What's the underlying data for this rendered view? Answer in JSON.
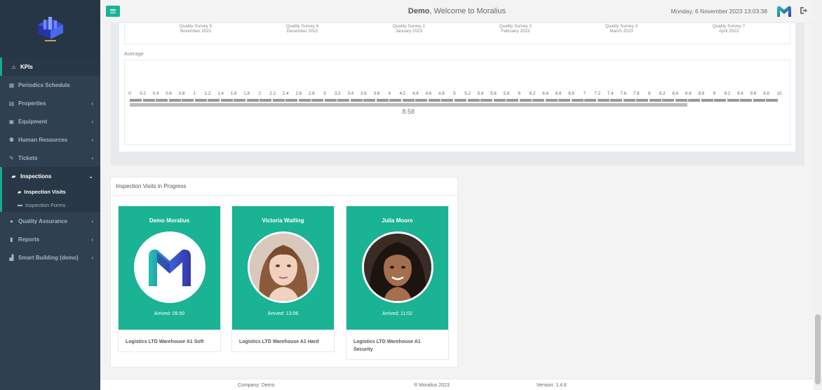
{
  "header": {
    "brand": "Demo",
    "welcome": ", Welcome to Moralius",
    "datetime": "Monday, 6 November 2023 13:03:38"
  },
  "sidebar": {
    "items": [
      {
        "label": "KPIs",
        "icon": "home-icon",
        "active": true
      },
      {
        "label": "Periodics Schedule",
        "icon": "calendar-icon"
      },
      {
        "label": "Properties",
        "icon": "building-icon",
        "chevron": true
      },
      {
        "label": "Equipment",
        "icon": "equipment-icon",
        "chevron": true
      },
      {
        "label": "Human Resources",
        "icon": "users-icon",
        "chevron": true
      },
      {
        "label": "Tickets",
        "icon": "tools-icon",
        "chevron": true
      },
      {
        "label": "Inspections",
        "icon": "map-icon",
        "open": true
      },
      {
        "label": "Quality Assurance",
        "icon": "search-icon",
        "chevron": true
      },
      {
        "label": "Reports",
        "icon": "book-icon",
        "chevron": true
      },
      {
        "label": "Smart Building (demo)",
        "icon": "chart-icon",
        "chevron": true
      }
    ],
    "subitems": [
      {
        "label": "Inspection Visits",
        "icon": "map-icon",
        "current": true
      },
      {
        "label": "Inspection Forms",
        "icon": "folder-icon"
      }
    ]
  },
  "surveys": [
    {
      "name": "Quality Survey 5",
      "date": "November 2022"
    },
    {
      "name": "Quality Survey 6",
      "date": "December 2022"
    },
    {
      "name": "Quality Survey 1",
      "date": "January 2023"
    },
    {
      "name": "Quality Survey 2",
      "date": "February 2023"
    },
    {
      "name": "Quality Survey 3",
      "date": "March 2023"
    },
    {
      "name": "Quality Survey 7",
      "date": "April 2023"
    }
  ],
  "average": {
    "label": "Average",
    "value": 8.58,
    "value_text": "8.58",
    "scale_min": 0,
    "scale_max": 10,
    "scale_step": 0.2,
    "scale_labels": [
      "0",
      "0.2",
      "0.4",
      "0.6",
      "0.8",
      "1",
      "1.2",
      "1.4",
      "1.6",
      "1.8",
      "2",
      "2.2",
      "2.4",
      "2.6",
      "2.8",
      "3",
      "3.2",
      "3.4",
      "3.6",
      "3.8",
      "4",
      "4.2",
      "4.4",
      "4.6",
      "4.8",
      "5",
      "5.2",
      "5.4",
      "5.6",
      "5.8",
      "6",
      "6.2",
      "6.4",
      "6.6",
      "6.8",
      "7",
      "7.2",
      "7.4",
      "7.6",
      "7.8",
      "8",
      "8.2",
      "8.4",
      "8.6",
      "8.8",
      "9",
      "9.2",
      "9.4",
      "9.6",
      "9.8",
      "10"
    ]
  },
  "visits": {
    "title": "Inspection Visits in Progress",
    "cards": [
      {
        "name": "Demo Moralius",
        "arrived": "Arrived: 09:50",
        "location": "Logistics LTD Warehouse A1 Soft",
        "avatar": "logo"
      },
      {
        "name": "Victoria Watling",
        "arrived": "Arrived: 13:06",
        "location": "Logistics LTD Warehouse A1 Hard",
        "avatar": "photo-light"
      },
      {
        "name": "Julia Moore",
        "arrived": "Arrived: 11:02",
        "location": "Logistics LTD Warehouse A1 Security",
        "avatar": "photo-dark"
      }
    ]
  },
  "footer": {
    "company": "Company: Demo",
    "copyright": "® Moralius 2023",
    "version": "Version: 1.4.8"
  },
  "colors": {
    "sidebar_bg": "#2f4050",
    "accent": "#1ab394"
  }
}
